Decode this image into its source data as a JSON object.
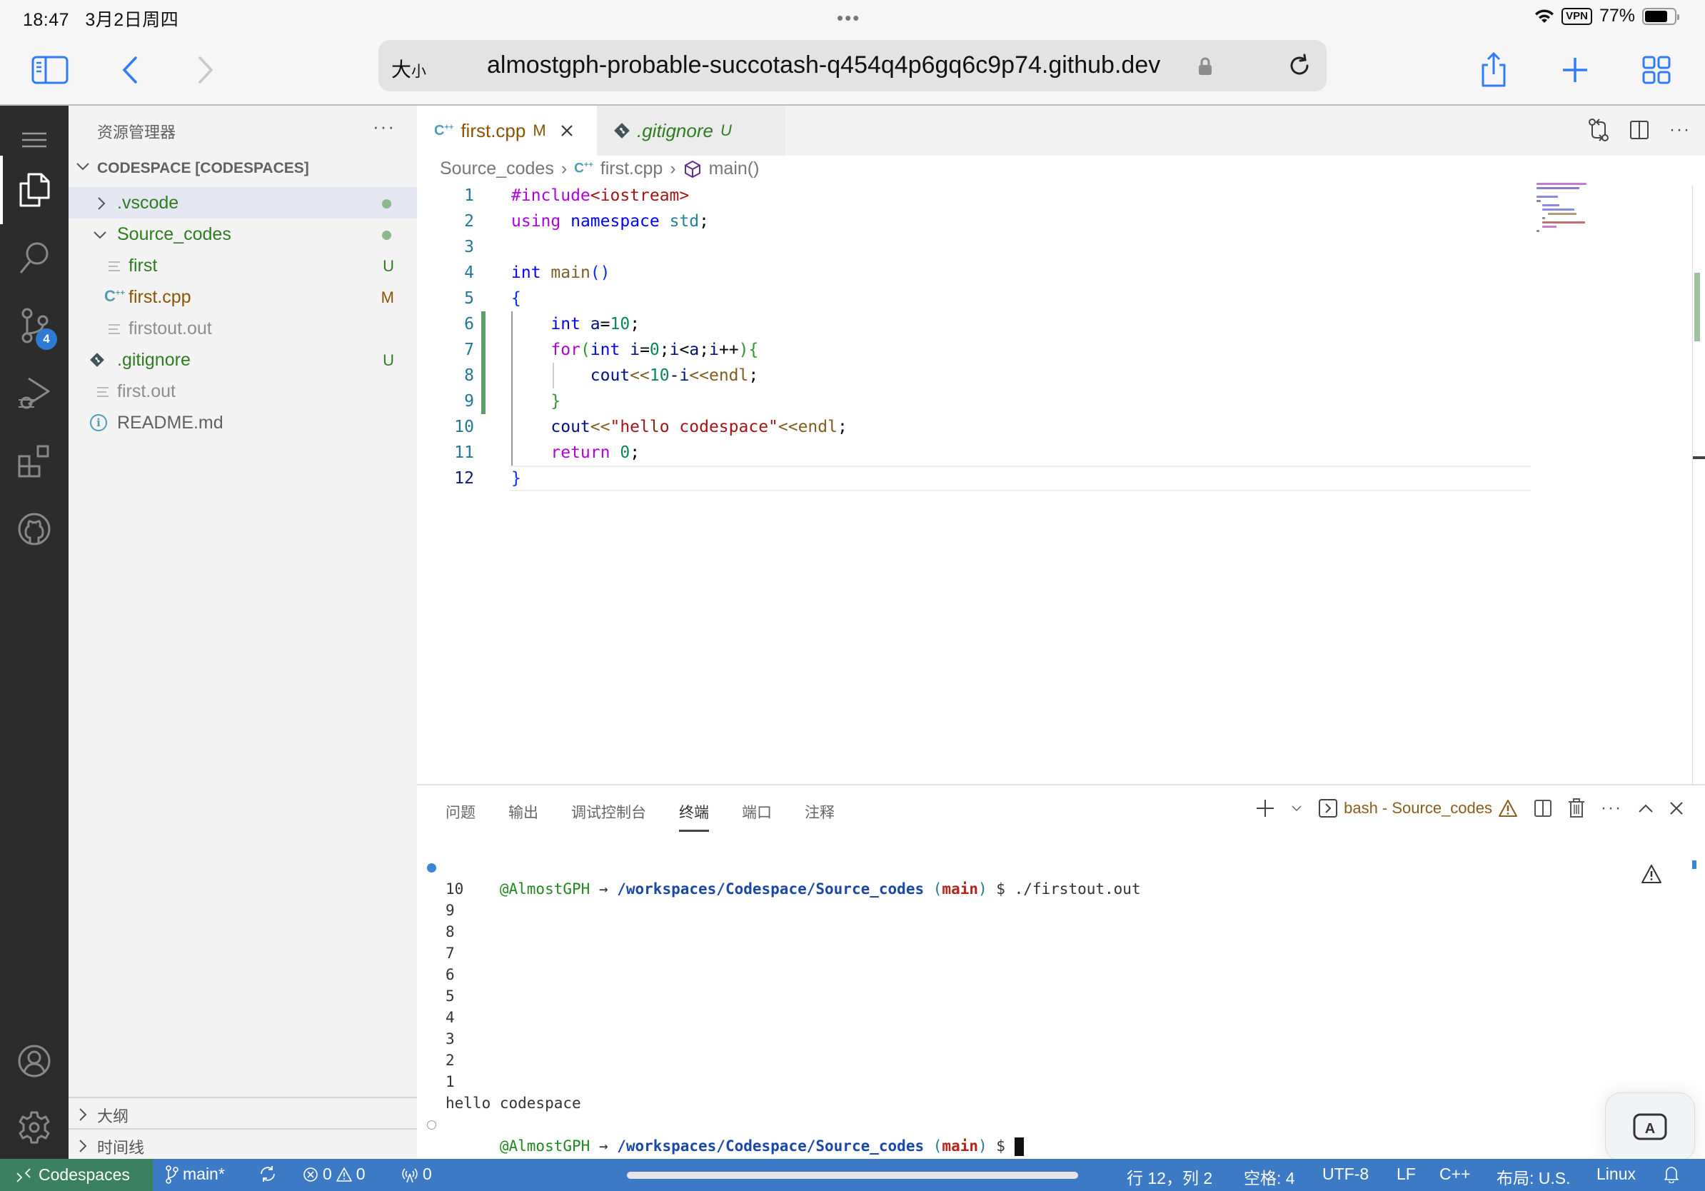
{
  "ios_status": {
    "time": "18:47",
    "date": "3月2日周四",
    "vpn": "VPN",
    "battery_percent": "77%",
    "battery_level": 0.77
  },
  "browser": {
    "text_size_label_big": "大",
    "text_size_label_small": "小",
    "url": "almostgph-probable-succotash-q454q4p6gq6c9p74.github.dev",
    "icons": [
      "sidebar-icon",
      "back-icon",
      "forward-icon",
      "lock-icon",
      "reload-icon",
      "share-icon",
      "new-tab-icon",
      "tabs-overview-icon"
    ]
  },
  "activity_bar": {
    "items": [
      "menu",
      "explorer",
      "search",
      "source-control",
      "run-debug",
      "extensions",
      "github",
      "accounts",
      "settings"
    ],
    "source_control_badge": "4"
  },
  "sidebar": {
    "title": "资源管理器",
    "more": "···",
    "section": "CODESPACE [CODESPACES]",
    "tree": [
      {
        "label": ".vscode",
        "type": "folder",
        "expanded": false,
        "decoration": "dot",
        "color": "#2d7d1f"
      },
      {
        "label": "Source_codes",
        "type": "folder",
        "expanded": true,
        "decoration": "dot",
        "color": "#2d7d1f"
      },
      {
        "label": "first",
        "type": "file",
        "decoration": "U",
        "color": "#2d7d1f"
      },
      {
        "label": "first.cpp",
        "type": "cpp",
        "decoration": "M",
        "color": "#895503"
      },
      {
        "label": "firstout.out",
        "type": "file",
        "decoration": "",
        "color": "#8e8e8e"
      },
      {
        "label": ".gitignore",
        "type": "git",
        "decoration": "U",
        "color": "#2d7d1f"
      },
      {
        "label": "first.out",
        "type": "file",
        "decoration": "",
        "color": "#8e8e8e"
      },
      {
        "label": "README.md",
        "type": "info",
        "decoration": "",
        "color": "#616161"
      }
    ],
    "outline": "大纲",
    "timeline": "时间线"
  },
  "editor": {
    "tabs": [
      {
        "label": "first.cpp",
        "badge": "M",
        "active": true
      },
      {
        "label": ".gitignore",
        "badge": "U",
        "active": false
      }
    ],
    "breadcrumb": [
      "Source_codes",
      "first.cpp",
      "main()"
    ],
    "line_numbers": [
      "1",
      "2",
      "3",
      "4",
      "5",
      "6",
      "7",
      "8",
      "9",
      "10",
      "11",
      "12"
    ],
    "current_line": 12,
    "modified_lines": [
      6,
      9
    ]
  },
  "panel": {
    "tabs": [
      "问题",
      "输出",
      "调试控制台",
      "终端",
      "端口",
      "注释"
    ],
    "active_tab": "终端",
    "terminal_name": "bash - Source_codes",
    "prompt": {
      "user": "@AlmostGPH",
      "arrow": " → ",
      "path": "/workspaces/Codespace/Source_codes",
      "branch": "main",
      "dollar": " $ "
    },
    "command": "./firstout.out",
    "output": [
      "10",
      "9",
      "8",
      "7",
      "6",
      "5",
      "4",
      "3",
      "2",
      "1",
      "hello codespace"
    ],
    "keyboard_button": "A"
  },
  "status_bar": {
    "remote": "Codespaces",
    "branch": "main*",
    "errors": "0",
    "warnings": "0",
    "ports": "0",
    "position": "行 12，列 2",
    "spaces": "空格: 4",
    "encoding": "UTF-8",
    "eol": "LF",
    "language": "C++",
    "layout": "布局: U.S.",
    "os": "Linux"
  }
}
